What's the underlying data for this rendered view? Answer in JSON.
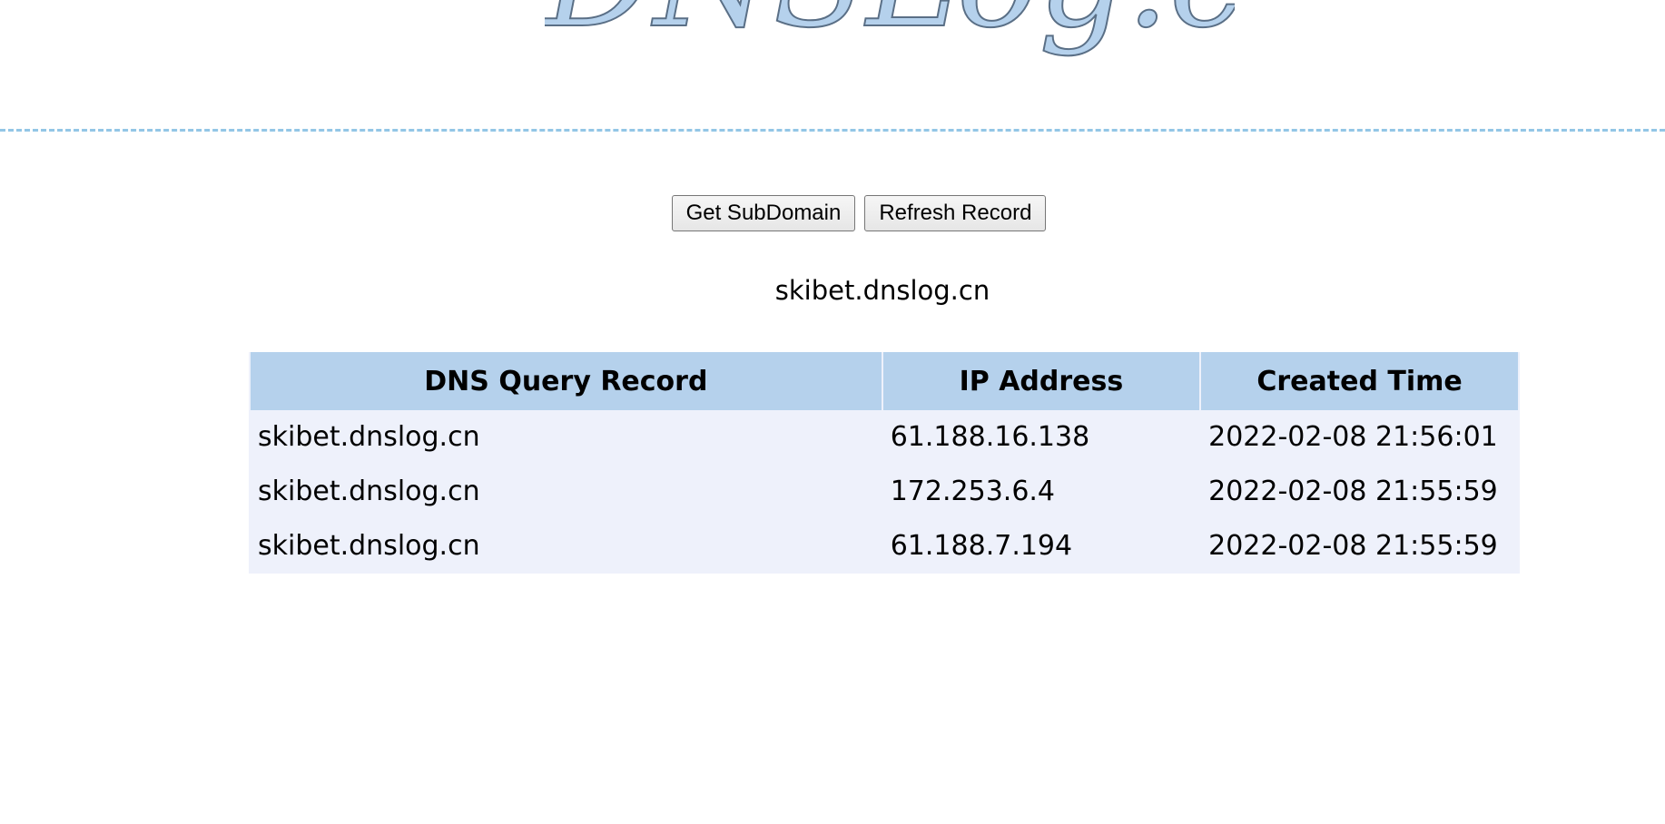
{
  "logo": {
    "text": "DNSLog.cn"
  },
  "actions": {
    "get_subdomain": "Get SubDomain",
    "refresh_record": "Refresh Record"
  },
  "subdomain": "skibet.dnslog.cn",
  "table": {
    "headers": [
      "DNS Query Record",
      "IP Address",
      "Created Time"
    ],
    "rows": [
      {
        "record": "skibet.dnslog.cn",
        "ip": "61.188.16.138",
        "time": "2022-02-08 21:56:01"
      },
      {
        "record": "skibet.dnslog.cn",
        "ip": "172.253.6.4",
        "time": "2022-02-08 21:55:59"
      },
      {
        "record": "skibet.dnslog.cn",
        "ip": "61.188.7.194",
        "time": "2022-02-08 21:55:59"
      }
    ]
  },
  "colors": {
    "logo_fill": "#b5d1ec",
    "divider": "#93c6e6",
    "header_bg": "#b5d1ec",
    "row_bg": "#eef1fb"
  }
}
